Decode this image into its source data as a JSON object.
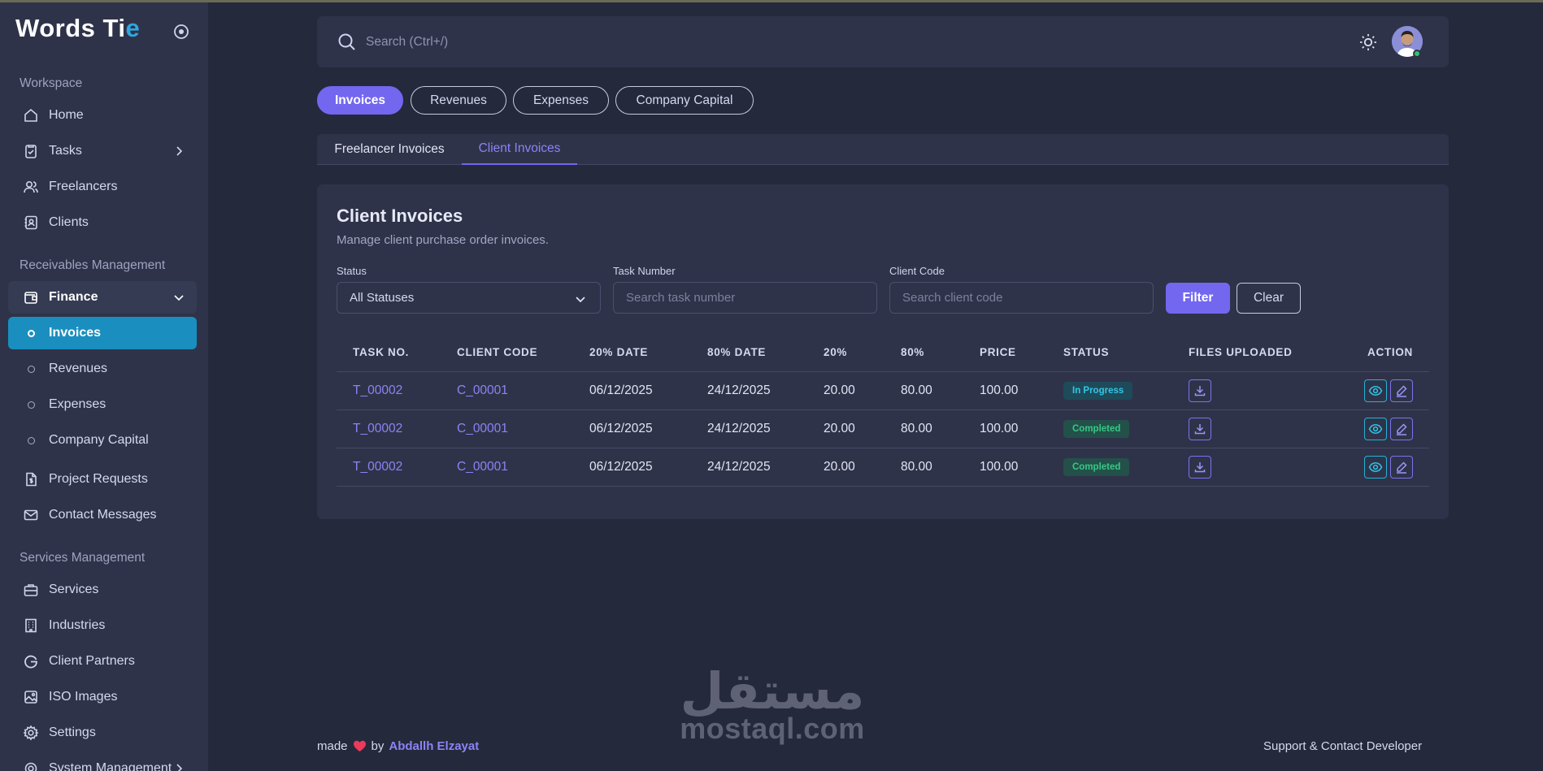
{
  "app": {
    "brand_main": "Words Ti",
    "brand_accent": "e",
    "brand_accent_color": "#2ea8e0"
  },
  "sidebar": {
    "section_workspace": "Workspace",
    "section_receivables": "Receivables Management",
    "section_services": "Services Management",
    "items": {
      "home": "Home",
      "tasks": "Tasks",
      "freelancers": "Freelancers",
      "clients": "Clients",
      "finance": "Finance",
      "invoices": "Invoices",
      "revenues": "Revenues",
      "expenses": "Expenses",
      "company_capital": "Company Capital",
      "project_requests": "Project Requests",
      "contact_messages": "Contact Messages",
      "services": "Services",
      "industries": "Industries",
      "client_partners": "Client Partners",
      "iso_images": "ISO Images",
      "settings": "Settings",
      "system_management": "System Management"
    },
    "active_item": "invoices"
  },
  "topbar": {
    "search_placeholder": "Search (Ctrl+/)",
    "online_status_color": "#28c76f"
  },
  "pills": [
    {
      "label": "Invoices",
      "active": true
    },
    {
      "label": "Revenues",
      "active": false
    },
    {
      "label": "Expenses",
      "active": false
    },
    {
      "label": "Company Capital",
      "active": false
    }
  ],
  "subtabs": [
    {
      "label": "Freelancer Invoices",
      "active": false
    },
    {
      "label": "Client Invoices",
      "active": true
    }
  ],
  "card": {
    "title": "Client Invoices",
    "subtitle": "Manage client purchase order invoices.",
    "filters": {
      "status_label": "Status",
      "status_value": "All Statuses",
      "task_label": "Task Number",
      "task_placeholder": "Search task number",
      "client_label": "Client Code",
      "client_placeholder": "Search client code",
      "filter_button": "Filter",
      "clear_button": "Clear"
    },
    "table": {
      "headers": [
        "TASK NO.",
        "CLIENT CODE",
        "20% DATE",
        "80% DATE",
        "20%",
        "80%",
        "PRICE",
        "STATUS",
        "FILES UPLOADED",
        "ACTION"
      ],
      "rows": [
        {
          "task": "T_00002",
          "client": "C_00001",
          "date20": "06/12/2025",
          "date80": "24/12/2025",
          "p20": "20.00",
          "p80": "80.00",
          "price": "100.00",
          "status": "In Progress",
          "status_kind": "progress"
        },
        {
          "task": "T_00002",
          "client": "C_00001",
          "date20": "06/12/2025",
          "date80": "24/12/2025",
          "p20": "20.00",
          "p80": "80.00",
          "price": "100.00",
          "status": "Completed",
          "status_kind": "completed"
        },
        {
          "task": "T_00002",
          "client": "C_00001",
          "date20": "06/12/2025",
          "date80": "24/12/2025",
          "p20": "20.00",
          "p80": "80.00",
          "price": "100.00",
          "status": "Completed",
          "status_kind": "completed"
        }
      ]
    }
  },
  "footer": {
    "made": "made",
    "by": "by",
    "author": "Abdallh Elzayat",
    "support": "Support & Contact Developer"
  },
  "watermark": {
    "arabic": "مستقل",
    "latin": "mostaql.com"
  },
  "colors": {
    "primary": "#7367f0",
    "active_nav": "#1a8fbf",
    "background": "#25293c",
    "surface": "#2f3349"
  }
}
